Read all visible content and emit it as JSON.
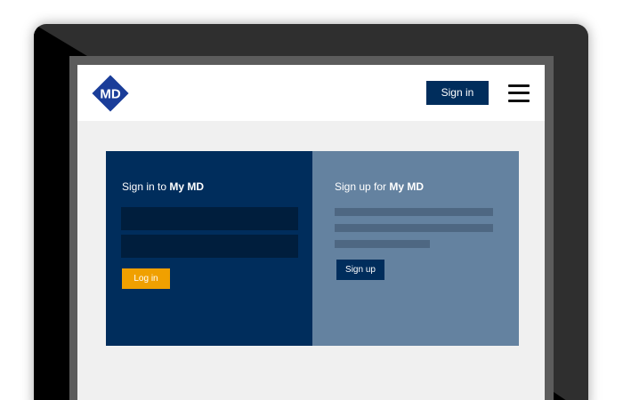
{
  "header": {
    "logo_text": "MD",
    "signin_label": "Sign in",
    "menu_icon": "hamburger-menu-icon"
  },
  "signin_panel": {
    "title_prefix": "Sign in to",
    "title_brand": "My MD",
    "username_value": "",
    "password_value": "",
    "login_label": "Log in"
  },
  "signup_panel": {
    "title_prefix": "Sign up for",
    "title_brand": "My MD",
    "signup_label": "Sign up"
  },
  "colors": {
    "brand_navy": "#002d5c",
    "field_dark": "#001e3d",
    "signup_panel": "#6482a0",
    "accent_orange": "#f0a000",
    "page_background": "#f0f0f0"
  }
}
